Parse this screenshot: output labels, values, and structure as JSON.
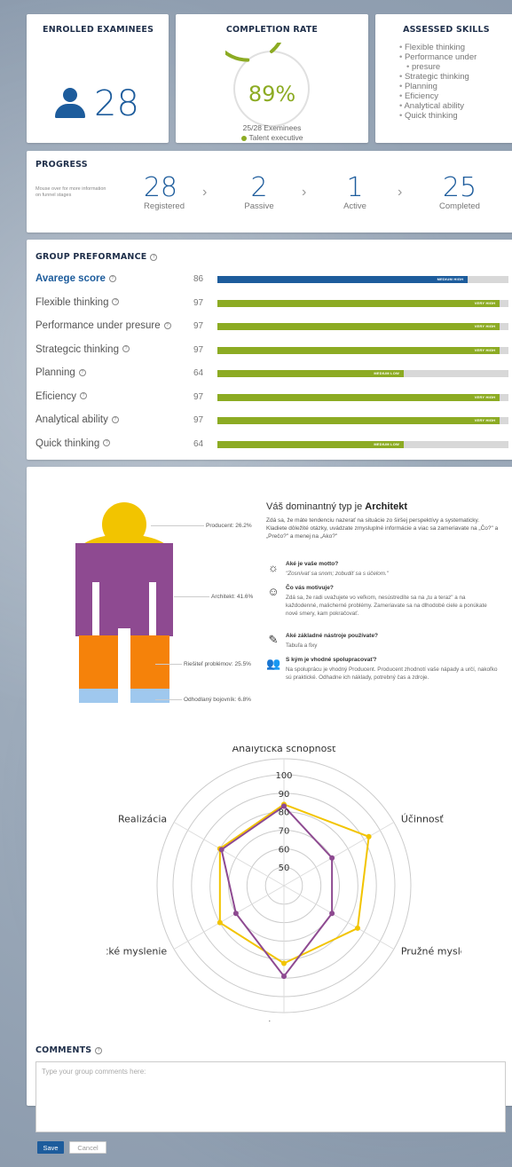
{
  "enrolled": {
    "title": "ENROLLED EXAMINEES",
    "count": "28",
    "icon": "person-icon"
  },
  "completion": {
    "title": "COMPLETION RATE",
    "percent_label": "89%",
    "fraction": 0.89,
    "examinees": "25/28 Exeminees",
    "legend": "Talent executive",
    "color": "#8cab23"
  },
  "skills": {
    "title": "ASSESSED SKILLS",
    "items": [
      "Flexible thinking",
      "Performance under",
      "presure",
      "Strategic thinking",
      "Planning",
      "Eficiency",
      "Analytical ability",
      "Quick thinking"
    ]
  },
  "progress": {
    "title": "PROGRESS",
    "hint": "Mouse over for more information on funnel stages",
    "stages": [
      {
        "value": "28",
        "label": "Registered"
      },
      {
        "value": "2",
        "label": "Passive"
      },
      {
        "value": "1",
        "label": "Active"
      },
      {
        "value": "25",
        "label": "Completed"
      }
    ]
  },
  "group": {
    "title": "GROUP PREFORMANCE",
    "rows": [
      {
        "label": "Avarege score",
        "value": "86",
        "level": "MEDIUM HIGH",
        "fill": 0.86,
        "color": "#1d5c9c"
      },
      {
        "label": "Flexible thinking",
        "value": "97",
        "level": "VERY HIGH",
        "fill": 0.97,
        "color": "#8cab23"
      },
      {
        "label": "Performance under presure",
        "value": "97",
        "level": "VERY HIGH",
        "fill": 0.97,
        "color": "#8cab23"
      },
      {
        "label": "Strategcic thinking",
        "value": "97",
        "level": "VERY HIGH",
        "fill": 0.97,
        "color": "#8cab23"
      },
      {
        "label": "Planning",
        "value": "64",
        "level": "MEDIUM LOW",
        "fill": 0.64,
        "color": "#8cab23"
      },
      {
        "label": "Eficiency",
        "value": "97",
        "level": "VERY HIGH",
        "fill": 0.97,
        "color": "#8cab23"
      },
      {
        "label": "Analytical ability",
        "value": "97",
        "level": "VERY HIGH",
        "fill": 0.97,
        "color": "#8cab23"
      },
      {
        "label": "Quick thinking",
        "value": "64",
        "level": "MEDIUM LOW",
        "fill": 0.64,
        "color": "#8cab23"
      }
    ]
  },
  "figure": {
    "producent": "Producent: 26.2%",
    "architekt": "Architekt: 41.6%",
    "riesitel": "Riešiteľ problémov: 25.5%",
    "odhodlany": "Odhodlaný bojovník: 6.8%",
    "colors": {
      "producent": "#f2c400",
      "architekt": "#8e4a91",
      "riesitel": "#f5820a",
      "odhodlany": "#9fc8ee"
    }
  },
  "architect": {
    "title_prefix": "Váš dominantný typ je ",
    "title_type": "Architekt",
    "intro": "Zdá sa, že máte tendenciu nazerať na situácie zo širšej perspektívy a systematicky. Kladiete dôležité otázky, uvádzate zmysluplné informácie a viac sa zameriavate na „Čo?\" a „Prečo?\" a menej na „Ako?\"",
    "questions": [
      {
        "icon": "lightbulb-icon",
        "title": "Aké je vaše motto?",
        "text": "\"Zosnívať sa snom; zobudiť sa s účelom.\""
      },
      {
        "icon": "smiley-icon",
        "title": "Čo vás motivuje?",
        "text": "Zdá sa, že radi uvažujete vo veľkom, nesústredíte sa na „tu a teraz\" a na každodenné, malicherné problémy. Zameriavate sa na dlhodobé ciele a ponúkate nové smery, kam pokračovať."
      },
      {
        "icon": "wrench-icon",
        "title": "Aké základné nástroje používate?",
        "text": "Tabuľa a fixy"
      },
      {
        "icon": "people-icon",
        "title": "S kým je vhodné spolupracovať?",
        "text": "Na spoluprácu je vhodný Producent. Producent zhodnotí vaše nápady a určí, nakoľko sú praktické. Odhadne ich náklady, potrebný čas a zdroje."
      }
    ]
  },
  "chart_data": {
    "type": "radar",
    "axes": [
      "Analytická schopnosť",
      "Účinnosť",
      "Pružné myslenie",
      "Plánovanie",
      "Strategické myslenie",
      "Realizácia"
    ],
    "ticks": [
      "50",
      "60",
      "70",
      "80",
      "90",
      "100"
    ],
    "range": [
      40,
      100
    ],
    "series": [
      {
        "values": [
          84,
          93,
          86,
          82,
          80,
          80
        ],
        "color": "#f2c400"
      },
      {
        "values": [
          83,
          70,
          70,
          89,
          70,
          79
        ],
        "color": "#8e4a91"
      }
    ]
  },
  "comments": {
    "title": "COMMENTS",
    "placeholder": "Type your group comments here:",
    "save": "Save",
    "cancel": "Cancel"
  }
}
